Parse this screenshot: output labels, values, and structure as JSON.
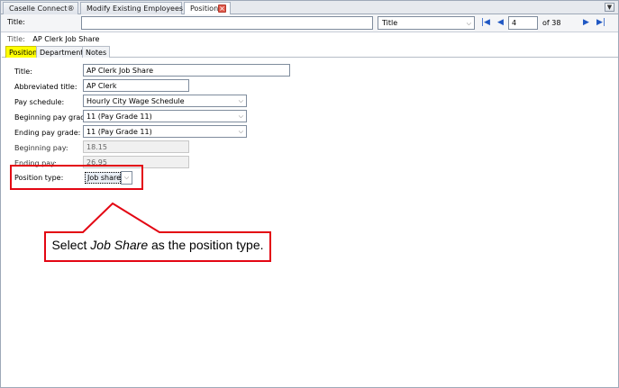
{
  "doc_tabs": [
    {
      "label": "Caselle Connect®"
    },
    {
      "label": "Modify Existing Employees"
    },
    {
      "label": "Positions"
    }
  ],
  "toolbar": {
    "title_label": "Title:",
    "search_value": "",
    "search_field": "Title",
    "record": "4",
    "of_total": "of 38"
  },
  "record_title": {
    "label": "Title:",
    "value": "AP Clerk Job Share"
  },
  "sub_tabs": [
    {
      "label": "Position"
    },
    {
      "label": "Departments"
    },
    {
      "label": "Notes"
    }
  ],
  "form": {
    "title_label": "Title:",
    "title_value": "AP Clerk Job Share",
    "abbr_label": "Abbreviated title:",
    "abbr_value": "AP Clerk",
    "pay_schedule_label": "Pay schedule:",
    "pay_schedule_value": "Hourly City Wage Schedule",
    "beg_grade_label": "Beginning pay grade:",
    "beg_grade_value": "11 (Pay Grade 11)",
    "end_grade_label": "Ending pay grade:",
    "end_grade_value": "11 (Pay Grade 11)",
    "beg_pay_label": "Beginning pay:",
    "beg_pay_value": "18.15",
    "end_pay_label": "Ending pay:",
    "end_pay_value": "26.95",
    "ptype_label": "Position type:",
    "ptype_value": "Job share"
  },
  "callout": {
    "before": "Select ",
    "emph": "Job Share",
    "after": " as the position type."
  },
  "colors": {
    "highlight": "#e30613",
    "active_tab": "#ffff00",
    "nav_blue": "#1f57c3"
  }
}
